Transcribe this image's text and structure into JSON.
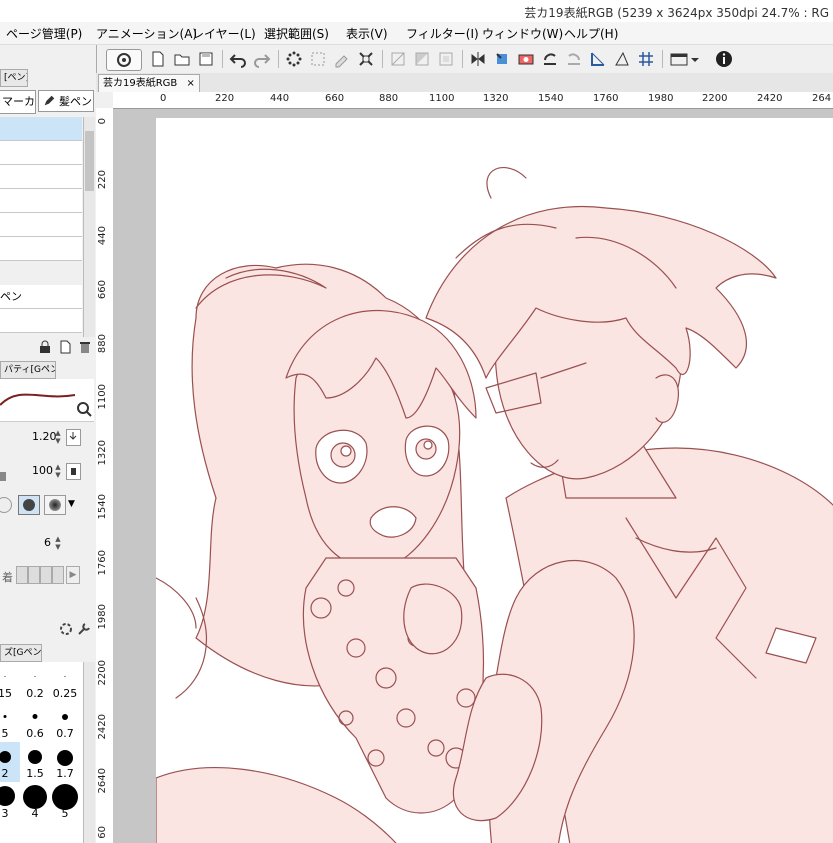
{
  "window": {
    "title": "芸カ19表紙RGB (5239 x 3624px 350dpi 24.7% : RG"
  },
  "menu": [
    {
      "label": "ページ管理(P)"
    },
    {
      "label": "アニメーション(A)"
    },
    {
      "label": "レイヤー(L)"
    },
    {
      "label": "選択範囲(S)"
    },
    {
      "label": "表示(V)"
    },
    {
      "label": "フィルター(I)"
    },
    {
      "label": "ウィンドウ(W)"
    },
    {
      "label": "ヘルプ(H)"
    }
  ],
  "toolbar": {
    "icons": [
      "logo-icon",
      "new-file-icon",
      "open-file-icon",
      "save-icon",
      "undo-icon",
      "redo-icon",
      "transform-icon",
      "select-all-icon",
      "clear-selection-icon",
      "fit-icon",
      "snap-icon",
      "gradient-icon",
      "frame-icon",
      "flip-icon",
      "export-icon",
      "camera-icon",
      "rotate-left-icon",
      "rotate-right-icon",
      "ruler-icon",
      "perspective-icon",
      "grid-icon",
      "panel-icon",
      "info-icon"
    ]
  },
  "left_panel": {
    "tool_tab": "[ペン]",
    "sub_tools": [
      "マーカ",
      "髪ペン"
    ],
    "brush_list": [
      "",
      "",
      "",
      "",
      "",
      "",
      "ペン",
      ""
    ],
    "property_tab": "パティ[Gペン]",
    "brush_size": "1.20",
    "opacity": "100",
    "stabilization": "6",
    "anchor_label": "着",
    "size_tab": "ズ[Gペン]",
    "size_presets": [
      "15",
      "0.2",
      "0.25",
      "5",
      "0.6",
      "0.7",
      "2",
      "1.5",
      "1.7",
      "3",
      "4",
      "5"
    ]
  },
  "document": {
    "tab": "芸カ19表紙RGB",
    "ruler_h": [
      "0",
      "220",
      "440",
      "660",
      "880",
      "1100",
      "1320",
      "1540",
      "1760",
      "1980",
      "2200",
      "2420",
      "264"
    ],
    "ruler_v": [
      "0",
      "220",
      "440",
      "660",
      "880",
      "1100",
      "1320",
      "1540",
      "1760",
      "1980",
      "2200",
      "2420",
      "2640",
      "60"
    ]
  },
  "colors": {
    "line_art": "#9a5050",
    "skin": "#fbe5e3",
    "canvas": "#ffffff",
    "workspace": "#c6c6c6"
  }
}
